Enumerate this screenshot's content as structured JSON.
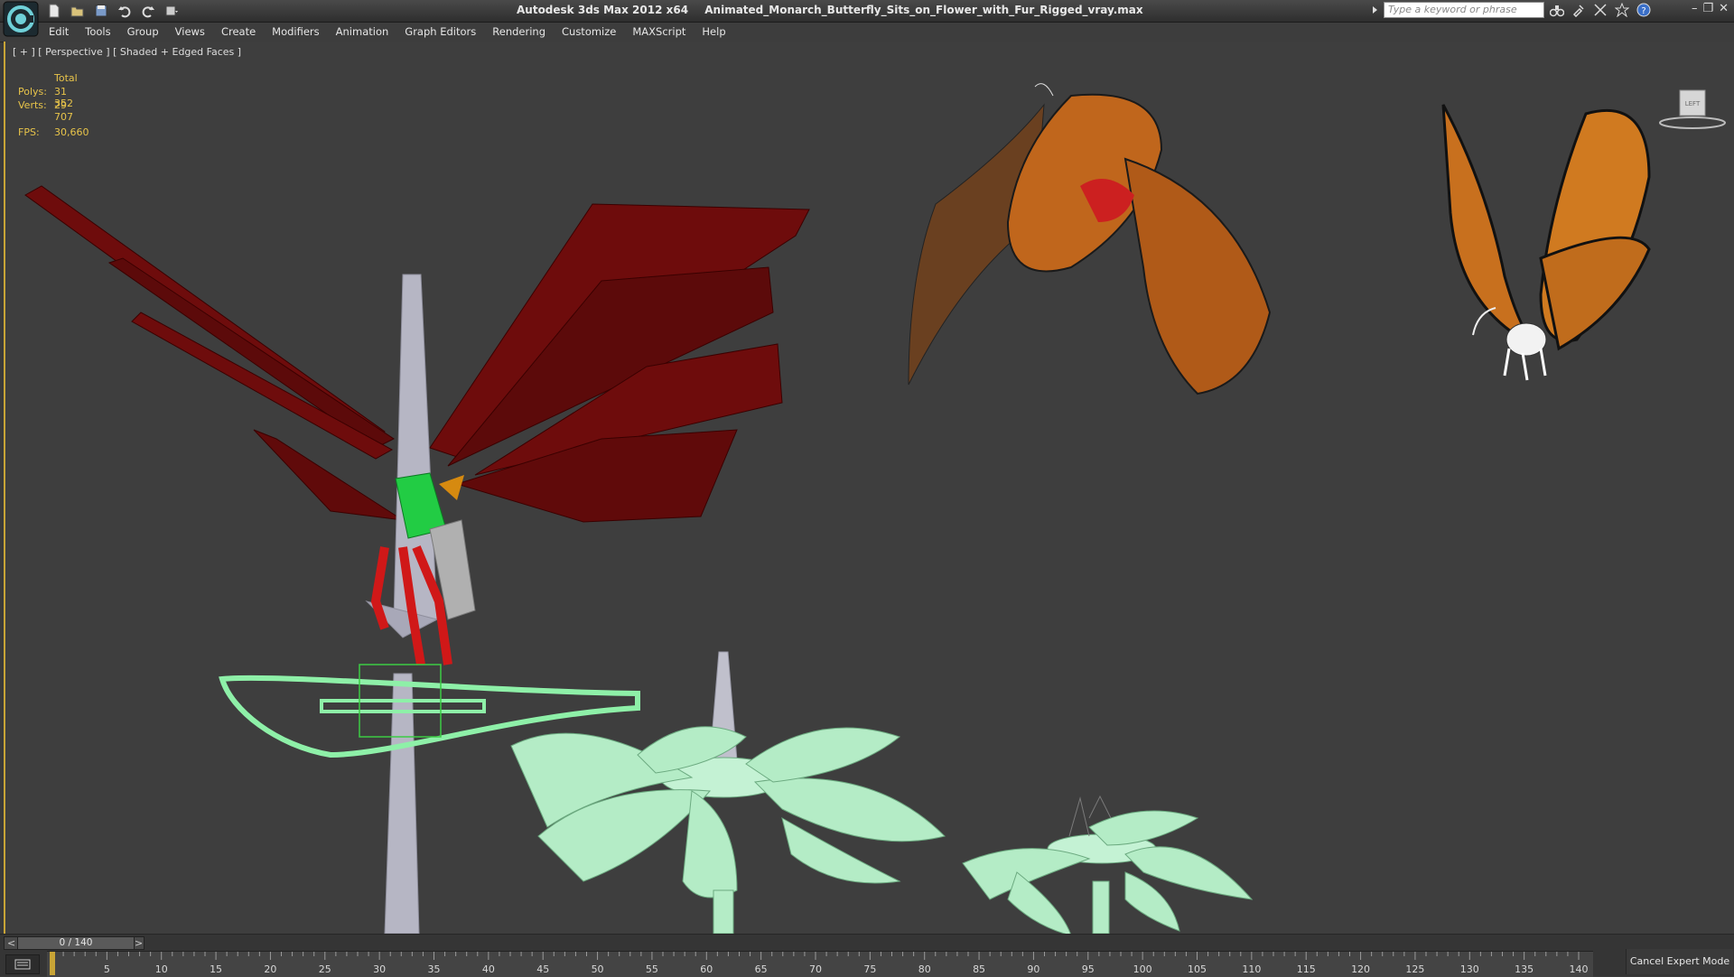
{
  "window": {
    "app_title": "Autodesk 3ds Max  2012 x64",
    "file_title": "Animated_Monarch_Butterfly_Sits_on_Flower_with_Fur_Rigged_vray.max",
    "search_placeholder": "Type a keyword or phrase"
  },
  "quick_access": [
    "new-icon",
    "open-icon",
    "save-icon",
    "undo-icon",
    "redo-icon",
    "project-icon"
  ],
  "menu": [
    "Edit",
    "Tools",
    "Group",
    "Views",
    "Create",
    "Modifiers",
    "Animation",
    "Graph Editors",
    "Rendering",
    "Customize",
    "MAXScript",
    "Help"
  ],
  "viewport": {
    "label": "[ + ] [ Perspective ] [ Shaded + Edged Faces ]",
    "stats": {
      "total_label": "Total",
      "polys_label": "Polys:",
      "polys_value": "31 352",
      "verts_label": "Verts:",
      "verts_value": "29 707",
      "fps_label": "FPS:",
      "fps_value": "30,660"
    },
    "viewcube_label": "LEFT"
  },
  "timeline": {
    "frame_display": "0 / 140",
    "prev": "<",
    "next": ">",
    "ticks": [
      "5",
      "10",
      "15",
      "20",
      "25",
      "30",
      "35",
      "40",
      "45",
      "50",
      "55",
      "60",
      "65",
      "70",
      "75",
      "80",
      "85",
      "90",
      "95",
      "100",
      "105",
      "110",
      "115",
      "120",
      "125",
      "130",
      "135",
      "140"
    ],
    "current_frame": 0,
    "total_frames": 140
  },
  "cancel_expert_mode": "Cancel Expert Mode",
  "colors": {
    "viewport_bg": "#3e3e3e",
    "active_border": "#c8a436",
    "stats_text": "#e8c44a",
    "wing_red": "#6e0c0c",
    "flower_green": "#b4ecc6"
  }
}
